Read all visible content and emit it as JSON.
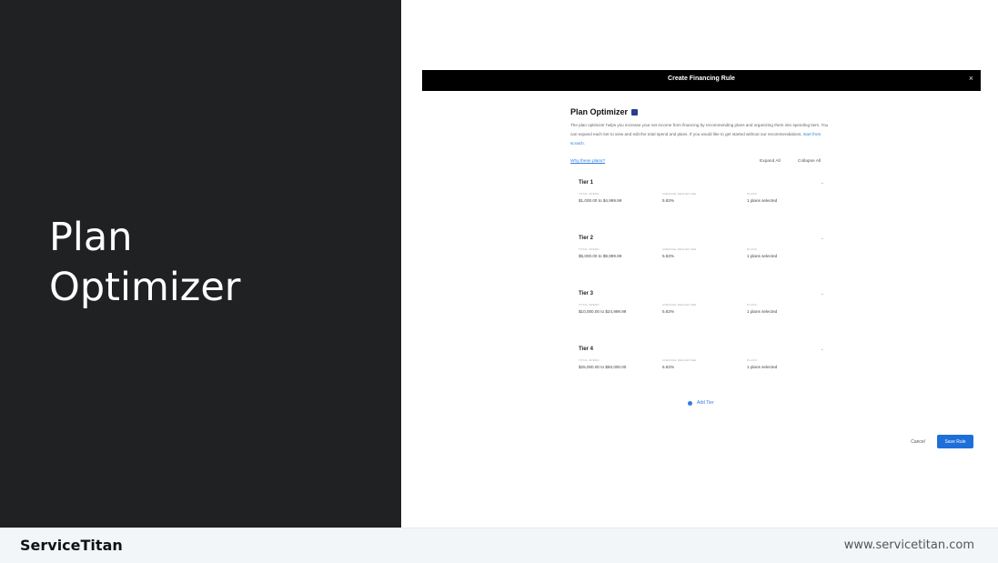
{
  "slide": {
    "title_line1": "Plan",
    "title_line2": "Optimizer"
  },
  "footer": {
    "brand": "ServiceTitan",
    "url": "www.servicetitan.com"
  },
  "modal": {
    "title": "Create Financing Rule",
    "close_icon": "×"
  },
  "optimizer": {
    "title": "Plan Optimizer",
    "description": "The plan optimizer helps you increase your net income from financing by recommending plans and organizing them into spending tiers. You can expand each tier to view and edit the total spend and plans. If you would like to get started without our recommendations,",
    "start_scratch_link": "start from scratch.",
    "why_link": "Why these plans?",
    "expand_all": "Expand All",
    "collapse_all": "Collapse All"
  },
  "column_labels": {
    "total_spend": "TOTAL SPEND",
    "dealer_fee": "AVERAGE DEALER FEE",
    "plans": "PLANS"
  },
  "tiers": [
    {
      "name": "Tier 1",
      "total_spend": "$1,000.00 to $4,999.99",
      "dealer_fee": "5.83%",
      "plans": "1 plans selected"
    },
    {
      "name": "Tier 2",
      "total_spend": "$5,000.00 to $9,999.99",
      "dealer_fee": "5.83%",
      "plans": "1 plans selected"
    },
    {
      "name": "Tier 3",
      "total_spend": "$10,000.00 to $24,999.99",
      "dealer_fee": "5.83%",
      "plans": "1 plans selected"
    },
    {
      "name": "Tier 4",
      "total_spend": "$25,000.00 to $50,000.00",
      "dealer_fee": "5.83%",
      "plans": "1 plans selected"
    }
  ],
  "actions": {
    "add_tier": "Add Tier",
    "cancel": "Cancel",
    "save": "Save Rule"
  },
  "colors": {
    "accent": "#1e6fd9",
    "link": "#2d7fe0",
    "dark_panel": "#1f2122",
    "header": "#000000"
  }
}
